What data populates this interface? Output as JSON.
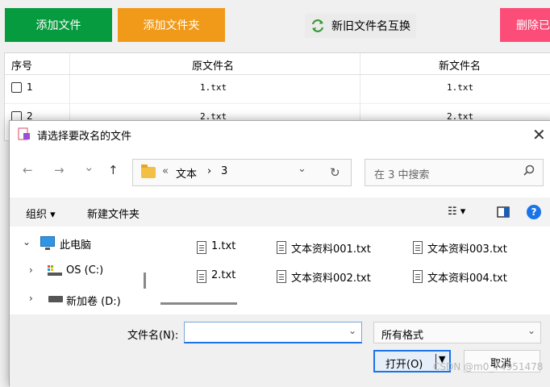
{
  "toolbar": {
    "add_file": "添加文件",
    "add_folder": "添加文件夹",
    "swap_names": "新旧文件名互换",
    "delete_label": "删除已",
    "colors": {
      "add_file": "#079b3f",
      "add_folder": "#f19a1a",
      "delete": "#fb4d78"
    }
  },
  "table": {
    "headers": {
      "index": "序号",
      "original": "原文件名",
      "new": "新文件名"
    },
    "rows": [
      {
        "index": "1",
        "original": "1.txt",
        "new": "1.txt"
      },
      {
        "index": "2",
        "original": "2.txt",
        "new": "2.txt"
      }
    ]
  },
  "dialog": {
    "title": "请选择要改名的文件",
    "close": "✕",
    "nav": {
      "back": "←",
      "forward": "→",
      "recent": "⌄",
      "up": "↑"
    },
    "address": {
      "prefix": "«",
      "crumbs": [
        "文本",
        "›",
        "3"
      ],
      "dropdown": "⌄",
      "refresh": "↻"
    },
    "search": {
      "placeholder": "在 3 中搜索",
      "icon": "search-icon"
    },
    "commands": {
      "organize": "组织 ▾",
      "new_folder": "新建文件夹",
      "view": "☷ ▾",
      "help": "?"
    },
    "tree": [
      {
        "label": "此电脑",
        "arrow": "⌄",
        "icon": "computer-icon"
      },
      {
        "label": "OS (C:)",
        "arrow": "›",
        "icon": "drive-icon"
      },
      {
        "label": "新加卷 (D:)",
        "arrow": "›",
        "icon": "drive-icon"
      }
    ],
    "files": [
      "1.txt",
      "文本资料001.txt",
      "文本资料003.txt",
      "2.txt",
      "文本资料002.txt",
      "文本资料004.txt"
    ],
    "filename_label": "文件名(N):",
    "filename_value": "",
    "filter_value": "所有格式",
    "open_button": "打开(O)",
    "cancel_button": "取消"
  },
  "watermark": "CSDN @m0_74951478"
}
